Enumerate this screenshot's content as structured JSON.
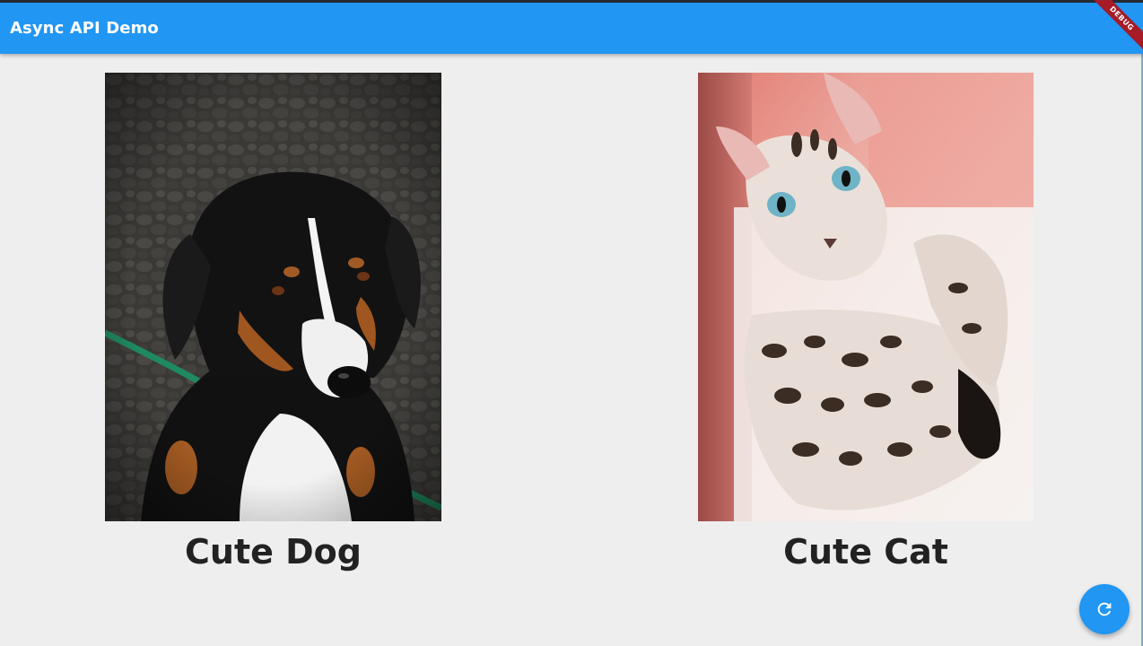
{
  "appbar": {
    "title": "Async API Demo",
    "color": "#2196f3"
  },
  "debug_banner": {
    "label": "DEBUG",
    "color": "#a51b28"
  },
  "cards": [
    {
      "caption": "Cute Dog",
      "image_icon": "dog-photo"
    },
    {
      "caption": "Cute Cat",
      "image_icon": "cat-photo"
    }
  ],
  "fab": {
    "icon": "refresh-icon",
    "color": "#2196f3"
  }
}
